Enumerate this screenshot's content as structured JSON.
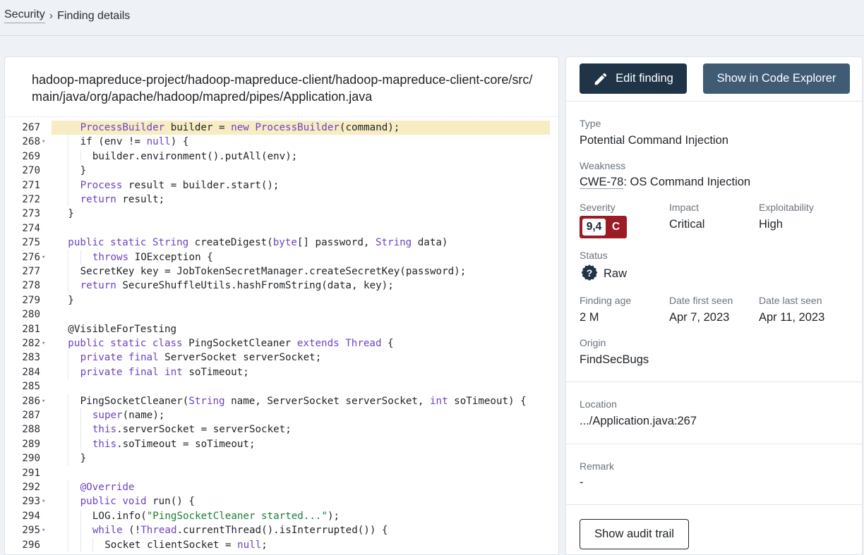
{
  "breadcrumb": {
    "root": "Security",
    "separator": "›",
    "current": "Finding details"
  },
  "code_panel": {
    "file_path": "hadoop-mapreduce-project/hadoop-mapreduce-client/hadoop-mapreduce-client-core/src/main/java/org/apache/hadoop/mapred/pipes/Application.java",
    "highlighted_line": 267,
    "lines": [
      {
        "n": "267",
        "fold": "",
        "indent": 2,
        "tokens": [
          [
            "ProcessBuilder",
            "ty"
          ],
          [
            " builder = "
          ],
          [
            "new",
            "kw"
          ],
          [
            " "
          ],
          [
            "ProcessBuilder",
            "ty"
          ],
          [
            "(command);"
          ]
        ]
      },
      {
        "n": "268",
        "fold": "▾",
        "indent": 2,
        "tokens": [
          [
            "if (env != "
          ],
          [
            "null",
            "nl"
          ],
          [
            ") {"
          ]
        ]
      },
      {
        "n": "269",
        "fold": "",
        "indent": 3,
        "tokens": [
          [
            "builder.environment().putAll(env);"
          ]
        ]
      },
      {
        "n": "270",
        "fold": "",
        "indent": 2,
        "tokens": [
          [
            "}"
          ]
        ]
      },
      {
        "n": "271",
        "fold": "",
        "indent": 2,
        "tokens": [
          [
            "Process",
            "ty"
          ],
          [
            " result = builder.start();"
          ]
        ]
      },
      {
        "n": "272",
        "fold": "",
        "indent": 2,
        "tokens": [
          [
            "return",
            "kw"
          ],
          [
            " result;"
          ]
        ]
      },
      {
        "n": "273",
        "fold": "",
        "indent": 1,
        "tokens": [
          [
            "}"
          ]
        ]
      },
      {
        "n": "274",
        "fold": "",
        "indent": 0,
        "tokens": []
      },
      {
        "n": "275",
        "fold": "",
        "indent": 1,
        "tokens": [
          [
            "public static",
            "kw"
          ],
          [
            " "
          ],
          [
            "String",
            "ty"
          ],
          [
            " createDigest("
          ],
          [
            "byte",
            "kw"
          ],
          [
            "[] password, "
          ],
          [
            "String",
            "ty"
          ],
          [
            " data)"
          ]
        ]
      },
      {
        "n": "276",
        "fold": "▾",
        "indent": 3,
        "tokens": [
          [
            "throws",
            "kw"
          ],
          [
            " IOException {"
          ]
        ]
      },
      {
        "n": "277",
        "fold": "",
        "indent": 2,
        "tokens": [
          [
            "SecretKey key = JobTokenSecretManager.createSecretKey(password);"
          ]
        ]
      },
      {
        "n": "278",
        "fold": "",
        "indent": 2,
        "tokens": [
          [
            "return",
            "kw"
          ],
          [
            " SecureShuffleUtils.hashFromString(data, key);"
          ]
        ]
      },
      {
        "n": "279",
        "fold": "",
        "indent": 1,
        "tokens": [
          [
            "}"
          ]
        ]
      },
      {
        "n": "280",
        "fold": "",
        "indent": 0,
        "tokens": []
      },
      {
        "n": "281",
        "fold": "",
        "indent": 1,
        "tokens": [
          [
            "@VisibleForTesting"
          ]
        ]
      },
      {
        "n": "282",
        "fold": "▾",
        "indent": 1,
        "tokens": [
          [
            "public static class",
            "kw"
          ],
          [
            " PingSocketCleaner "
          ],
          [
            "extends",
            "kw"
          ],
          [
            " "
          ],
          [
            "Thread",
            "ty"
          ],
          [
            " {"
          ]
        ]
      },
      {
        "n": "283",
        "fold": "",
        "indent": 2,
        "tokens": [
          [
            "private final",
            "kw"
          ],
          [
            " ServerSocket serverSocket;"
          ]
        ]
      },
      {
        "n": "284",
        "fold": "",
        "indent": 2,
        "tokens": [
          [
            "private final int",
            "kw"
          ],
          [
            " soTimeout;"
          ]
        ]
      },
      {
        "n": "285",
        "fold": "",
        "indent": 0,
        "tokens": []
      },
      {
        "n": "286",
        "fold": "▾",
        "indent": 2,
        "tokens": [
          [
            "PingSocketCleaner("
          ],
          [
            "String",
            "ty"
          ],
          [
            " name, ServerSocket serverSocket, "
          ],
          [
            "int",
            "kw"
          ],
          [
            " soTimeout) {"
          ]
        ]
      },
      {
        "n": "287",
        "fold": "",
        "indent": 3,
        "tokens": [
          [
            "super",
            "kw"
          ],
          [
            "(name);"
          ]
        ]
      },
      {
        "n": "288",
        "fold": "",
        "indent": 3,
        "tokens": [
          [
            "this",
            "kw"
          ],
          [
            ".serverSocket = serverSocket;"
          ]
        ]
      },
      {
        "n": "289",
        "fold": "",
        "indent": 3,
        "tokens": [
          [
            "this",
            "kw"
          ],
          [
            ".soTimeout = soTimeout;"
          ]
        ]
      },
      {
        "n": "290",
        "fold": "",
        "indent": 2,
        "tokens": [
          [
            "}"
          ]
        ]
      },
      {
        "n": "291",
        "fold": "",
        "indent": 0,
        "tokens": []
      },
      {
        "n": "292",
        "fold": "",
        "indent": 2,
        "tokens": [
          [
            "@Override",
            "kw"
          ]
        ]
      },
      {
        "n": "293",
        "fold": "▾",
        "indent": 2,
        "tokens": [
          [
            "public void",
            "kw"
          ],
          [
            " run() {"
          ]
        ]
      },
      {
        "n": "294",
        "fold": "",
        "indent": 3,
        "tokens": [
          [
            "LOG.info("
          ],
          [
            "\"PingSocketCleaner started...\"",
            "str"
          ],
          [
            ");"
          ]
        ]
      },
      {
        "n": "295",
        "fold": "▾",
        "indent": 3,
        "tokens": [
          [
            "while",
            "kw"
          ],
          [
            " (!"
          ],
          [
            "Thread",
            "ty"
          ],
          [
            ".currentThread().isInterrupted()) {"
          ]
        ]
      },
      {
        "n": "296",
        "fold": "",
        "indent": 4,
        "tokens": [
          [
            "Socket clientSocket = "
          ],
          [
            "null",
            "nl"
          ],
          [
            ";"
          ]
        ]
      }
    ]
  },
  "details": {
    "edit_button_label": "Edit finding",
    "explorer_button_label": "Show in Code Explorer",
    "type_label": "Type",
    "type_value": "Potential Command Injection",
    "weakness_label": "Weakness",
    "weakness_cwe": "CWE-78",
    "weakness_rest": ": OS Command Injection",
    "severity_label": "Severity",
    "severity_score": "9,4",
    "severity_grade": "C",
    "impact_label": "Impact",
    "impact_value": "Critical",
    "exploitability_label": "Exploitability",
    "exploitability_value": "High",
    "status_label": "Status",
    "status_value": "Raw",
    "finding_age_label": "Finding age",
    "finding_age_value": "2 M",
    "date_first_label": "Date first seen",
    "date_first_value": "Apr 7, 2023",
    "date_last_label": "Date last seen",
    "date_last_value": "Apr 11, 2023",
    "origin_label": "Origin",
    "origin_value": "FindSecBugs",
    "location_label": "Location",
    "location_value": ".../Application.java:267",
    "remark_label": "Remark",
    "remark_value": "-",
    "audit_button_label": "Show audit trail"
  },
  "colors": {
    "edit_button": "#1f3547",
    "explorer_button": "#3f5c74",
    "severity_badge": "#9b1c24",
    "highlight_line": "#f8ecc3",
    "keyword": "#6f42c1",
    "string": "#1a7f37",
    "status_icon": "#1f3547"
  },
  "icons": {
    "edit": "pencil-icon",
    "status": "question-circle-icon",
    "fold": "chevron-down-icon"
  }
}
